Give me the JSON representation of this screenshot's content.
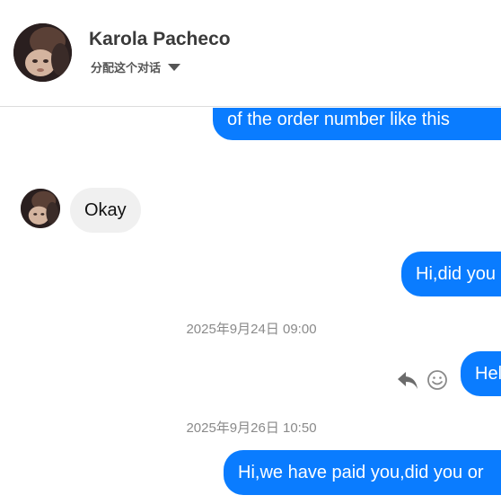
{
  "header": {
    "contact_name": "Karola Pacheco",
    "assign_label": "分配这个对话"
  },
  "messages": [
    {
      "direction": "outgoing",
      "text": "of the order number like this"
    },
    {
      "direction": "incoming",
      "text": "Okay"
    },
    {
      "direction": "outgoing",
      "text": "Hi,did you"
    },
    {
      "type": "timestamp",
      "text": "2025年9月24日 09:00"
    },
    {
      "direction": "outgoing",
      "text": "Hel"
    },
    {
      "type": "timestamp",
      "text": "2025年9月26日 10:50"
    },
    {
      "direction": "outgoing",
      "text": "Hi,we have paid you,did you or"
    }
  ],
  "icons": {
    "reply": "reply-icon",
    "react": "smiley-icon",
    "dropdown": "caret-down-icon"
  },
  "colors": {
    "outgoing_bubble": "#0a7cff",
    "incoming_bubble": "#f0f0f0",
    "timestamp_text": "#8a8a8a"
  }
}
